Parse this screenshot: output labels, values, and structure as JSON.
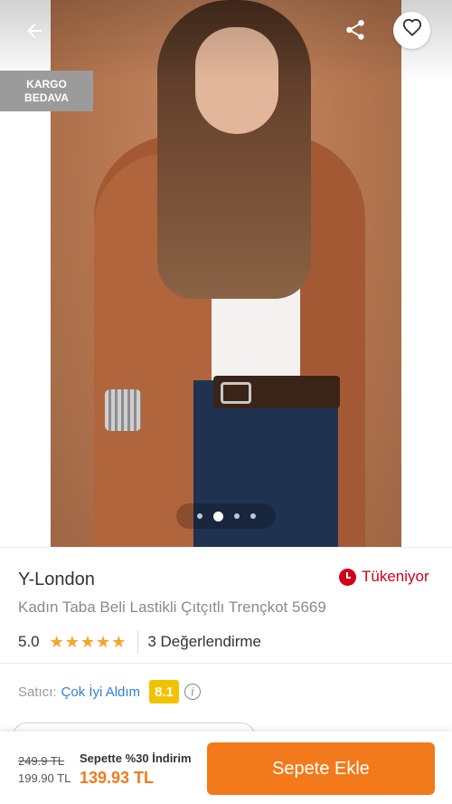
{
  "header": {
    "back_icon": "arrow-left-icon",
    "share_icon": "share-icon",
    "favorite_icon": "heart-outline-icon"
  },
  "badge": {
    "line1": "KARGO",
    "line2": "BEDAVA"
  },
  "gallery": {
    "image_count": 4,
    "active_index": 1
  },
  "product": {
    "brand": "Y-London",
    "stock_status": "Tükeniyor",
    "stock_icon": "clock-icon",
    "title": "Kadın Taba Beli Lastikli Çıtçıtlı Trençkot 5669",
    "rating": "5.0",
    "stars": "★★★★★",
    "review_count_label": "3 Değerlendirme"
  },
  "seller": {
    "label": "Satıcı:",
    "name": "Çok İyi Aldım",
    "score": "8.1",
    "info_icon": "info-icon"
  },
  "purchase": {
    "old_price": "249.9 TL",
    "price": "199.90 TL",
    "campaign": "Sepette %30 İndirim",
    "final_price": "139.93 TL",
    "add_to_cart": "Sepete Ekle"
  },
  "colors": {
    "accent": "#f27a1a",
    "stock_red": "#d0021b",
    "seller_link": "#2f80d1",
    "score_badge": "#f2c200",
    "star": "#f5a623"
  }
}
